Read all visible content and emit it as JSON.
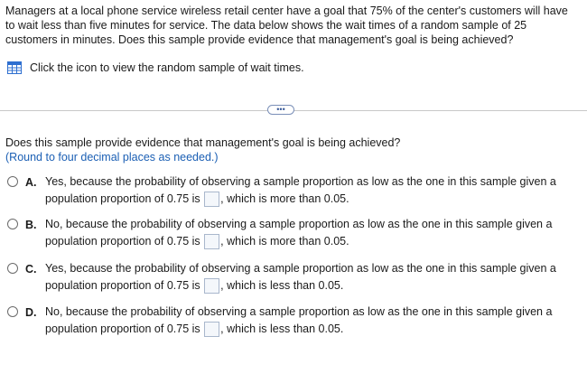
{
  "problem": {
    "text": "Managers at a local phone service wireless retail center have a goal that 75% of the center's customers will have to wait less than five minutes for service. The data below shows the wait times of a random sample of 25 customers in minutes. Does this sample provide evidence that management's goal is being achieved?"
  },
  "data_link": {
    "icon": "table-icon",
    "text": "Click the icon to view the random sample of wait times."
  },
  "more_button": {
    "label": "•••"
  },
  "question": {
    "text": "Does this sample provide evidence that management's goal is being achieved?",
    "hint": "(Round to four decimal places as needed.)"
  },
  "options": [
    {
      "letter": "A.",
      "before": "Yes, because the probability of observing a sample proportion as low as the one in this sample given a population proportion of 0.75 is",
      "after": ", which is more than 0.05."
    },
    {
      "letter": "B.",
      "before": "No, because the probability of observing a sample proportion as low as the one in this sample given a population proportion of 0.75 is",
      "after": ", which is more than 0.05."
    },
    {
      "letter": "C.",
      "before": "Yes, because the probability of observing a sample proportion as low as the one in this sample given a population proportion of 0.75 is",
      "after": ", which is less than 0.05."
    },
    {
      "letter": "D.",
      "before": "No, because the probability of observing a sample proportion as low as the one in this sample given a population proportion of 0.75 is",
      "after": ", which is less than 0.05."
    }
  ],
  "colors": {
    "hint": "#1b5fb4",
    "icon": "#2e6fd0"
  }
}
